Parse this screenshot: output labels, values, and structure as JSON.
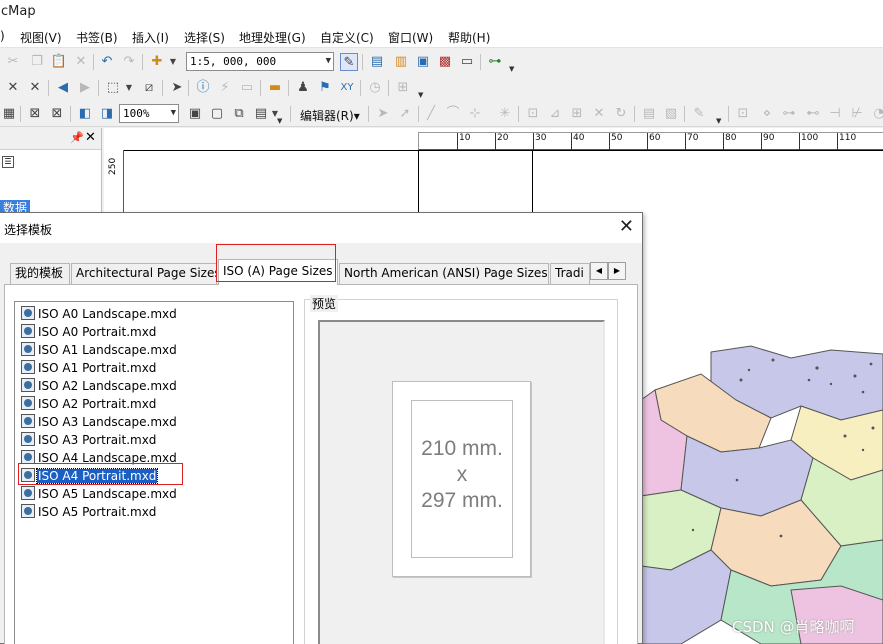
{
  "app": {
    "title": "cMap"
  },
  "menu": [
    "视图(V)",
    "书签(B)",
    "插入(I)",
    "选择(S)",
    "地理处理(G)",
    "自定义(C)",
    "窗口(W)",
    "帮助(H)"
  ],
  "toolbar": {
    "scale_value": "1:5, 000, 000",
    "zoom_value": "100%",
    "editor_label": "编辑器(R)▾"
  },
  "toc": {
    "selected_item": "数据"
  },
  "ruler": {
    "h_labels": [
      "10",
      "20",
      "30",
      "40",
      "50",
      "60",
      "70",
      "80",
      "90",
      "100",
      "110"
    ],
    "v_label": "250"
  },
  "dialog": {
    "title": "选择模板",
    "tabs": [
      "我的模板",
      "Architectural Page Sizes",
      "ISO (A) Page Sizes",
      "North American (ANSI) Page Sizes",
      "Tradi"
    ],
    "selected_tab": "ISO (A) Page Sizes",
    "templates": [
      "ISO A0 Landscape.mxd",
      "ISO A0 Portrait.mxd",
      "ISO A1 Landscape.mxd",
      "ISO A1 Portrait.mxd",
      "ISO A2 Landscape.mxd",
      "ISO A2 Portrait.mxd",
      "ISO A3 Landscape.mxd",
      "ISO A3 Portrait.mxd",
      "ISO A4 Landscape.mxd",
      "ISO A4 Portrait.mxd",
      "ISO A5 Landscape.mxd",
      "ISO A5 Portrait.mxd"
    ],
    "selected_template": "ISO A4 Portrait.mxd",
    "preview_label": "预览",
    "preview": {
      "line1": "210 mm.",
      "line2": "x",
      "line3": "297 mm."
    }
  },
  "watermark": "CSDN @肖略咖啊",
  "colors": {
    "selection": "#1b5ec4",
    "highlight_border": "#e02020"
  }
}
